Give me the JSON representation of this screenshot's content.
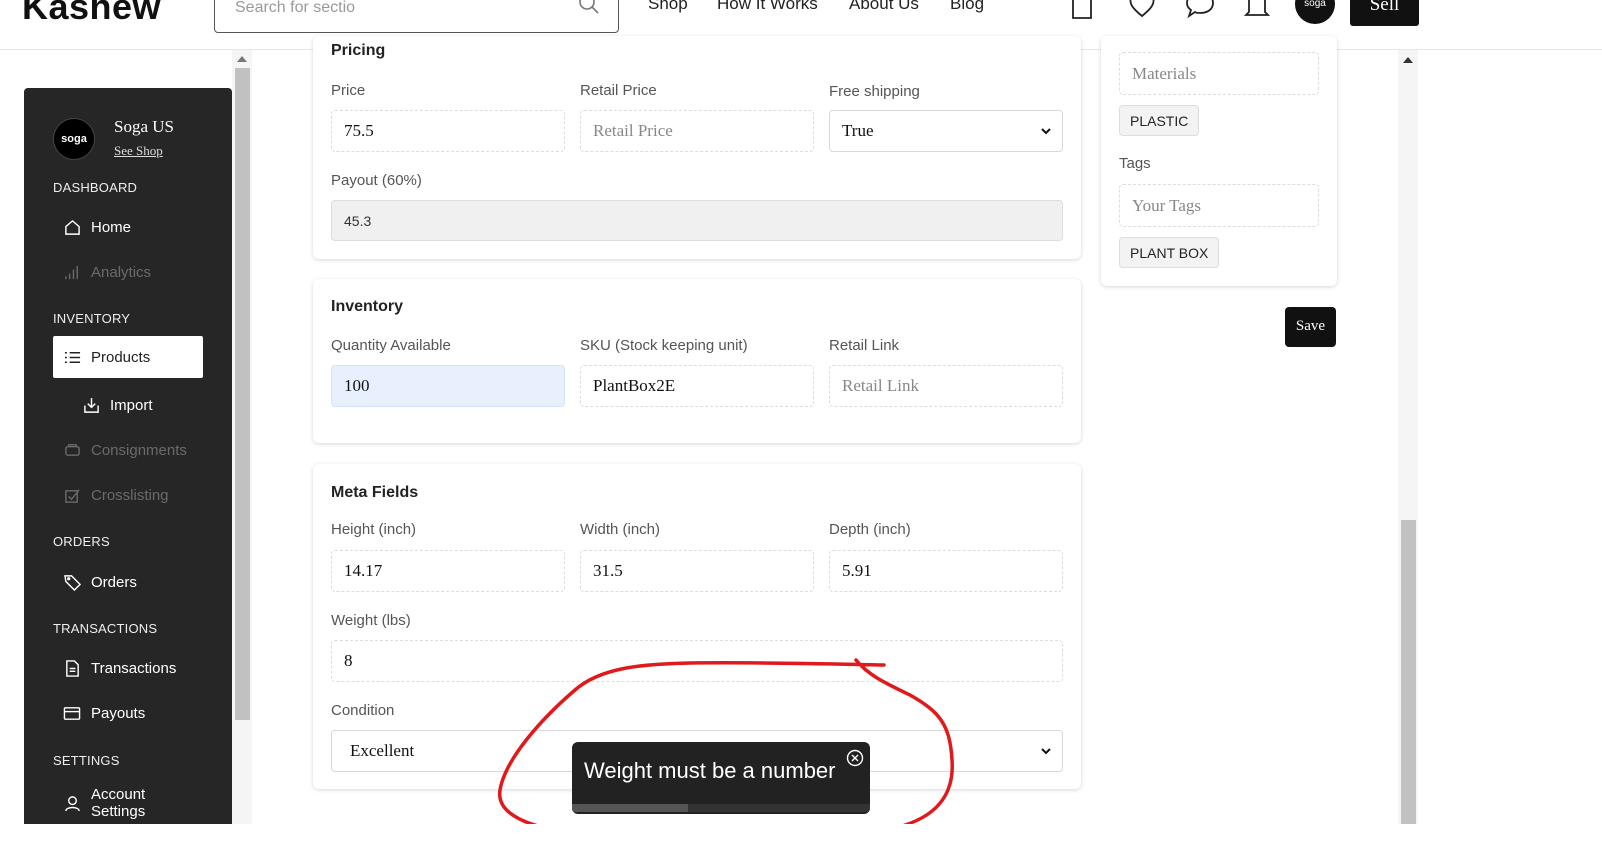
{
  "header": {
    "logo": "Kashew",
    "search_placeholder": "Search for sectio",
    "nav": [
      "Shop",
      "How It Works",
      "About Us",
      "Blog"
    ],
    "avatar_text": "soga",
    "sell_label": "Sell"
  },
  "sidebar": {
    "shop_avatar_text": "soga",
    "shop_name": "Soga US",
    "see_shop": "See Shop",
    "sections": {
      "dashboard": "DASHBOARD",
      "inventory": "INVENTORY",
      "orders": "ORDERS",
      "transactions": "TRANSACTIONS",
      "settings": "SETTINGS"
    },
    "items": {
      "home": "Home",
      "analytics": "Analytics",
      "products": "Products",
      "import": "Import",
      "consignments": "Consignments",
      "crosslisting": "Crosslisting",
      "orders": "Orders",
      "transactions": "Transactions",
      "payouts": "Payouts",
      "account_line1": "Account",
      "account_line2": "Settings"
    }
  },
  "pricing": {
    "title": "Pricing",
    "price_label": "Price",
    "price_value": "75.5",
    "retail_label": "Retail Price",
    "retail_placeholder": "Retail Price",
    "shipping_label": "Free shipping",
    "shipping_value": "True",
    "payout_label": "Payout (60%)",
    "payout_value": "45.3"
  },
  "inventory": {
    "title": "Inventory",
    "qty_label": "Quantity Available",
    "qty_value": "100",
    "sku_label": "SKU (Stock keeping unit)",
    "sku_value": "PlantBox2E",
    "link_label": "Retail Link",
    "link_placeholder": "Retail Link"
  },
  "meta": {
    "title": "Meta Fields",
    "height_label": "Height (inch)",
    "height_value": "14.17",
    "width_label": "Width (inch)",
    "width_value": "31.5",
    "depth_label": "Depth (inch)",
    "depth_value": "5.91",
    "weight_label": "Weight (lbs)",
    "weight_value": "8",
    "condition_label": "Condition",
    "condition_value": "Excellent"
  },
  "right_panel": {
    "materials_placeholder": "Materials",
    "material_chip": "PLASTIC",
    "tags_label": "Tags",
    "tags_placeholder": "Your Tags",
    "tag_chip": "PLANT BOX",
    "save_label": "Save"
  },
  "toast": {
    "message": "Weight must be a number",
    "progress": 0.39
  },
  "colors": {
    "sidebar_bg": "#262626",
    "annotation": "#e0191c",
    "focused_field": "#e8f0fe"
  }
}
